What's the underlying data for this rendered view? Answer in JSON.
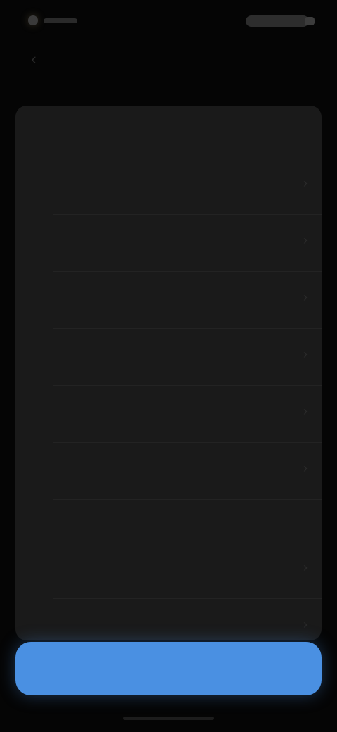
{
  "status_bar": {
    "time": "",
    "indicators": ""
  },
  "nav": {
    "back_icon": "chevron-left-icon",
    "title": "",
    "action_label": ""
  },
  "sections": [
    {
      "label": "",
      "meta": "",
      "items": [
        {
          "label": "",
          "value": ""
        },
        {
          "label": "",
          "value": ""
        },
        {
          "label": "",
          "value": ""
        },
        {
          "label": "",
          "value": ""
        },
        {
          "label": "",
          "value": ""
        },
        {
          "label": "",
          "value": ""
        }
      ]
    },
    {
      "label": "",
      "meta": "",
      "items": [
        {
          "label": "",
          "value": ""
        },
        {
          "label": "",
          "value": ""
        }
      ]
    }
  ],
  "primary_button": {
    "label": ""
  },
  "colors": {
    "background": "#050505",
    "card": "#1a1a1a",
    "accent": "#4a90e2"
  }
}
